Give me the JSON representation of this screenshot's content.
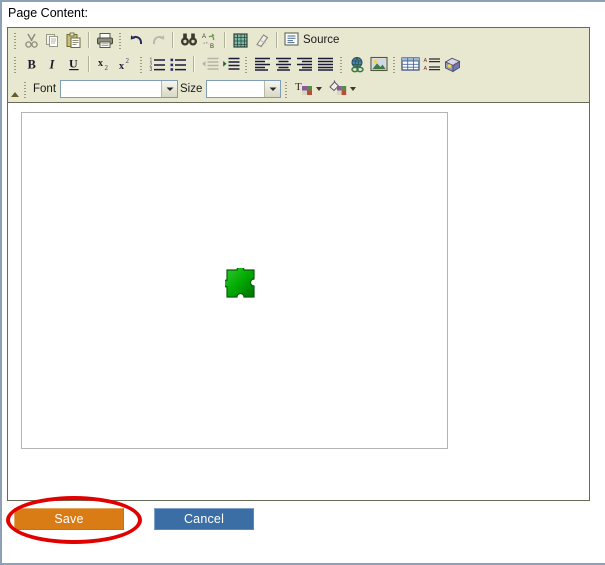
{
  "page": {
    "label": "Page Content:"
  },
  "editor": {
    "toolbar_rows": [
      {
        "row": 1,
        "items": [
          {
            "icon": "cut-icon",
            "label": "Cut"
          },
          {
            "icon": "copy-icon",
            "label": "Copy"
          },
          {
            "icon": "paste-icon",
            "label": "Paste"
          },
          {
            "icon": "print-icon",
            "label": "Print"
          },
          {
            "icon": "undo-icon",
            "label": "Undo"
          },
          {
            "icon": "redo-icon",
            "label": "Redo"
          },
          {
            "icon": "find-icon",
            "label": "Find"
          },
          {
            "icon": "replace-icon",
            "label": "Replace"
          },
          {
            "icon": "select-all-icon",
            "label": "Select All"
          },
          {
            "icon": "remove-format-icon",
            "label": "Remove Format"
          },
          {
            "icon": "source-icon",
            "label": "Source"
          }
        ]
      },
      {
        "row": 2,
        "items": [
          {
            "icon": "bold-icon",
            "label": "B"
          },
          {
            "icon": "italic-icon",
            "label": "I"
          },
          {
            "icon": "underline-icon",
            "label": "U"
          },
          {
            "icon": "subscript-icon",
            "label": "Subscript"
          },
          {
            "icon": "superscript-icon",
            "label": "Superscript"
          },
          {
            "icon": "numbered-list-icon",
            "label": "Insert/Remove Numbered List"
          },
          {
            "icon": "bulleted-list-icon",
            "label": "Insert/Remove Bulleted List"
          },
          {
            "icon": "outdent-icon",
            "label": "Decrease Indent"
          },
          {
            "icon": "indent-icon",
            "label": "Increase Indent"
          },
          {
            "icon": "align-left-icon",
            "label": "Align Left"
          },
          {
            "icon": "align-center-icon",
            "label": "Center"
          },
          {
            "icon": "align-right-icon",
            "label": "Align Right"
          },
          {
            "icon": "justify-icon",
            "label": "Justify"
          },
          {
            "icon": "link-icon",
            "label": "Link"
          },
          {
            "icon": "image-icon",
            "label": "Image"
          },
          {
            "icon": "table-icon",
            "label": "Table"
          },
          {
            "icon": "definition-list-icon",
            "label": "Definition List"
          },
          {
            "icon": "flash-object-icon",
            "label": "Flash"
          }
        ]
      }
    ],
    "font_combo": {
      "label": "Font",
      "value": "",
      "icon": "chevron-down-icon"
    },
    "size_combo": {
      "label": "Size",
      "value": "",
      "icon": "chevron-down-icon"
    },
    "text_color": {
      "icon": "text-color-icon",
      "label": "Text Color"
    },
    "bg_color": {
      "icon": "background-color-icon",
      "label": "Background Color"
    },
    "source_label": "Source",
    "collapse": {
      "icon": "collapse-toolbar-icon",
      "label": "Collapse Toolbar"
    },
    "body": {
      "object_placeholder": {
        "icon": "puzzle-piece-icon",
        "label": "Flash object placeholder"
      }
    }
  },
  "form": {
    "save_label": "Save",
    "cancel_label": "Cancel"
  },
  "annotation": {
    "shape": "ellipse",
    "target": "Save",
    "color": "#e00000"
  },
  "colors": {
    "toolbar_background": "#e8e8d0",
    "editor_border": "#696957",
    "save_button": "#d97c16",
    "cancel_button": "#3b6ea5",
    "annotation": "#e00000",
    "puzzle_green": "#00a000",
    "page_rule": "#8da0b8"
  }
}
